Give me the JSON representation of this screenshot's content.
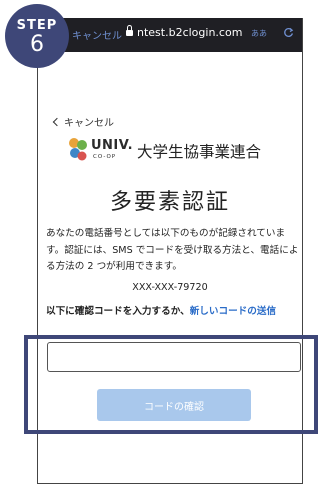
{
  "step": {
    "label": "STEP",
    "number": "6"
  },
  "browser": {
    "cancel_text": "キャンセル",
    "url": "ntest.b2clogin.com",
    "text_size": "ああ"
  },
  "back_link": "キャンセル",
  "logo": {
    "univ": "UNIV.",
    "coop": "CO-OP",
    "org_name": "大学生協事業連合"
  },
  "page_title": "多要素認証",
  "description": "あなたの電話番号としては以下のものが記録されています。認証には、SMS でコードを受け取る方法と、電話による方法の 2 つが利用できます。",
  "phone_number": "XXX-XXX-79720",
  "prompt": {
    "text": "以下に確認コードを入力するか、",
    "link": "新しいコードの送信"
  },
  "code_input": {
    "value": "",
    "placeholder": ""
  },
  "verify_button": "コードの確認",
  "colors": {
    "badge": "#3e4778",
    "link": "#2a6cc8",
    "button_disabled": "#a9c8ec",
    "highlight": "#3e4778"
  }
}
